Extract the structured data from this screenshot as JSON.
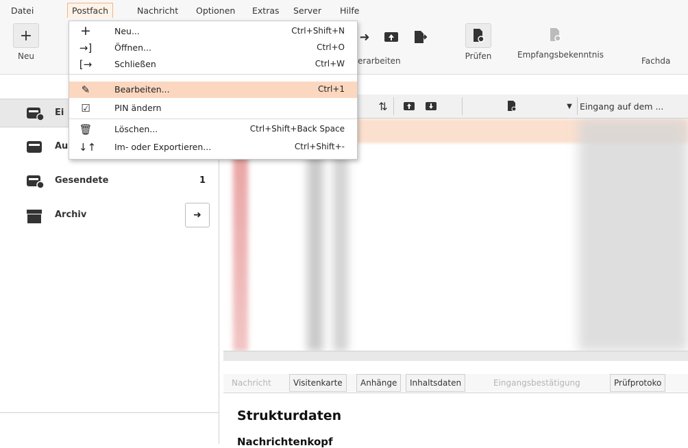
{
  "menubar": {
    "items": [
      "Datei",
      "Postfach",
      "Nachricht",
      "Optionen",
      "Extras",
      "Server",
      "Hilfe"
    ],
    "active": "Postfach"
  },
  "toolbar": {
    "neu_label": "Neu",
    "weiterverarbeiten_label": "rverarbeiten",
    "pruefen_label": "Prüfen",
    "empfangsbekenntnis_label": "Empfangsbekenntnis",
    "fachdaten_label": "Fachda"
  },
  "dropdown": {
    "items": [
      {
        "label": "Neu...",
        "shortcut": "Ctrl+Shift+N",
        "icon": "plus-icon"
      },
      {
        "label": "Öffnen...",
        "shortcut": "Ctrl+O",
        "icon": "open-icon"
      },
      {
        "label": "Schließen",
        "shortcut": "Ctrl+W",
        "icon": "close-icon"
      },
      {
        "label": "Bearbeiten...",
        "shortcut": "Ctrl+1",
        "icon": "pencil-icon"
      },
      {
        "label": "PIN ändern",
        "shortcut": "",
        "icon": "pin-edit-icon"
      },
      {
        "label": "Löschen...",
        "shortcut": "Ctrl+Shift+Back Space",
        "icon": "trash-icon"
      },
      {
        "label": "Im- oder Exportieren...",
        "shortcut": "Ctrl+Shift+-",
        "icon": "import-export-icon"
      }
    ],
    "highlighted": "Bearbeiten..."
  },
  "sidebar": {
    "items": [
      {
        "label": "Ei",
        "count": ""
      },
      {
        "label": "Au",
        "count": ""
      },
      {
        "label": "Gesendete",
        "count": "1"
      },
      {
        "label": "Archiv",
        "count": ""
      }
    ]
  },
  "messagelist": {
    "column_eingang": "Eingang auf dem ..."
  },
  "tabs": [
    {
      "label": "Nachricht",
      "enabled": false
    },
    {
      "label": "Visitenkarte",
      "enabled": true
    },
    {
      "label": "Anhänge",
      "enabled": true
    },
    {
      "label": "Inhaltsdaten",
      "enabled": true
    },
    {
      "label": "Eingangsbestätigung",
      "enabled": false
    },
    {
      "label": "Prüfprotoko",
      "enabled": true
    }
  ],
  "detail": {
    "title": "Strukturdaten",
    "subtitle": "Nachrichtenkopf"
  },
  "colors": {
    "menu_highlight": "#fbd7c0",
    "active_menu_border": "#f0b486"
  }
}
